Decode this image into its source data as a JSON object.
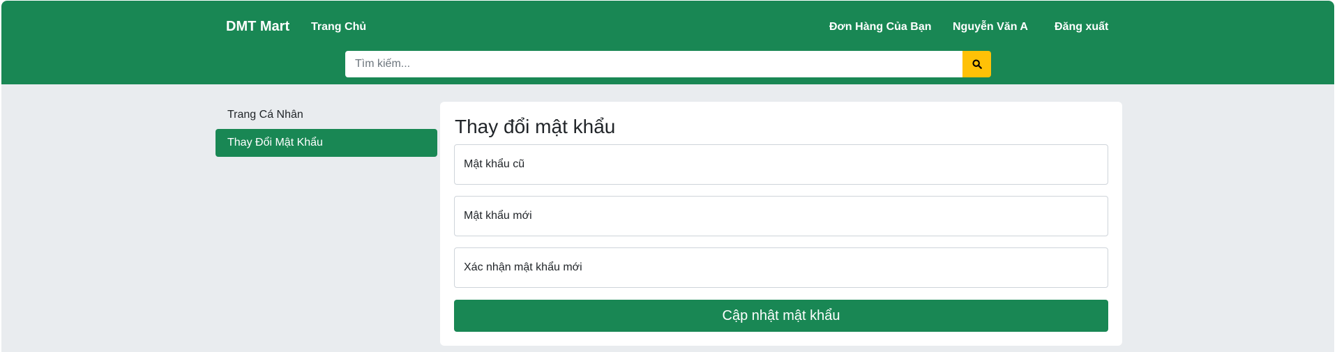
{
  "header": {
    "brand": "DMT Mart",
    "home_link": "Trang Chủ",
    "orders_link": "Đơn Hàng Của Bạn",
    "user_name": "Nguyễn Văn A",
    "logout_link": "Đăng xuất",
    "search_placeholder": "Tìm kiếm...",
    "search_icon": "search-icon"
  },
  "sidebar": {
    "items": [
      {
        "label": "Trang Cá Nhân",
        "active": false
      },
      {
        "label": "Thay Đổi Mật Khẩu",
        "active": true
      }
    ]
  },
  "main": {
    "title": "Thay đổi mật khẩu",
    "fields": {
      "old_password_placeholder": "Mật khẩu cũ",
      "new_password_placeholder": "Mật khẩu mới",
      "confirm_password_placeholder": "Xác nhận mật khẩu mới"
    },
    "submit_label": "Cập nhật mật khẩu"
  },
  "colors": {
    "primary_green": "#198754",
    "search_button_yellow": "#ffc107",
    "page_background": "#e9ecef"
  }
}
